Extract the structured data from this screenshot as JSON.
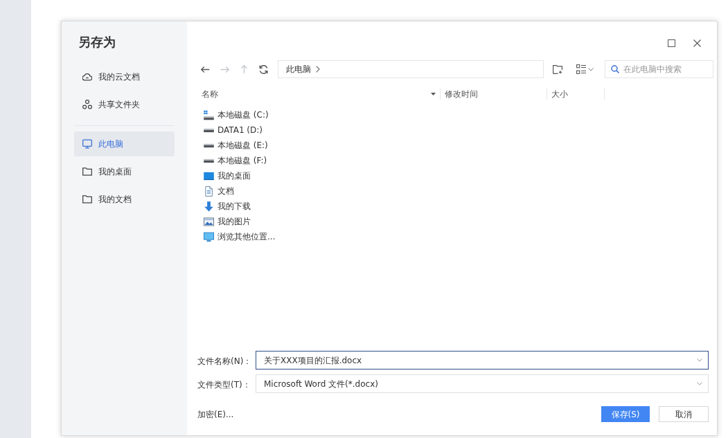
{
  "window": {
    "title": "另存为"
  },
  "sidebar": {
    "sections": [
      {
        "items": [
          {
            "label": "我的云文档",
            "kind": "cloud",
            "selected": false
          },
          {
            "label": "共享文件夹",
            "kind": "shared",
            "selected": false
          }
        ]
      },
      {
        "items": [
          {
            "label": "此电脑",
            "kind": "computer",
            "selected": true
          },
          {
            "label": "我的桌面",
            "kind": "folder",
            "selected": false
          },
          {
            "label": "我的文档",
            "kind": "folder",
            "selected": false
          }
        ]
      }
    ]
  },
  "toolbar": {
    "nav": [
      {
        "kind": "back",
        "disabled": false
      },
      {
        "kind": "forward",
        "disabled": true
      },
      {
        "kind": "up",
        "disabled": true
      },
      {
        "kind": "refresh",
        "disabled": false
      }
    ],
    "breadcrumb": [
      "此电脑"
    ],
    "search": {
      "placeholder": "在此电脑中搜索"
    }
  },
  "file_list": {
    "columns": [
      {
        "label": "名称",
        "sorted": true
      },
      {
        "label": "修改时间",
        "sorted": false
      },
      {
        "label": "大小",
        "sorted": false
      }
    ],
    "items": [
      {
        "name": "本地磁盘 (C:)",
        "kind": "system-drive"
      },
      {
        "name": "DATA1 (D:)",
        "kind": "drive"
      },
      {
        "name": "本地磁盘 (E:)",
        "kind": "drive"
      },
      {
        "name": "本地磁盘 (F:)",
        "kind": "drive"
      },
      {
        "name": "我的桌面",
        "kind": "desktop"
      },
      {
        "name": "文档",
        "kind": "documents"
      },
      {
        "name": "我的下载",
        "kind": "downloads"
      },
      {
        "name": "我的图片",
        "kind": "pictures"
      },
      {
        "name": "浏览其他位置...",
        "kind": "locations"
      }
    ]
  },
  "form": {
    "fields": [
      {
        "label": "文件名称(N)：",
        "value": "关于XXX项目的汇报.docx",
        "focused": true
      },
      {
        "label": "文件类型(T)：",
        "value": "Microsoft Word 文件(*.docx)",
        "focused": false
      }
    ],
    "encrypt_link": "加密(E)...",
    "buttons": [
      {
        "label": "保存(S)",
        "kind": "primary"
      },
      {
        "label": "取消",
        "kind": "secondary"
      }
    ]
  }
}
